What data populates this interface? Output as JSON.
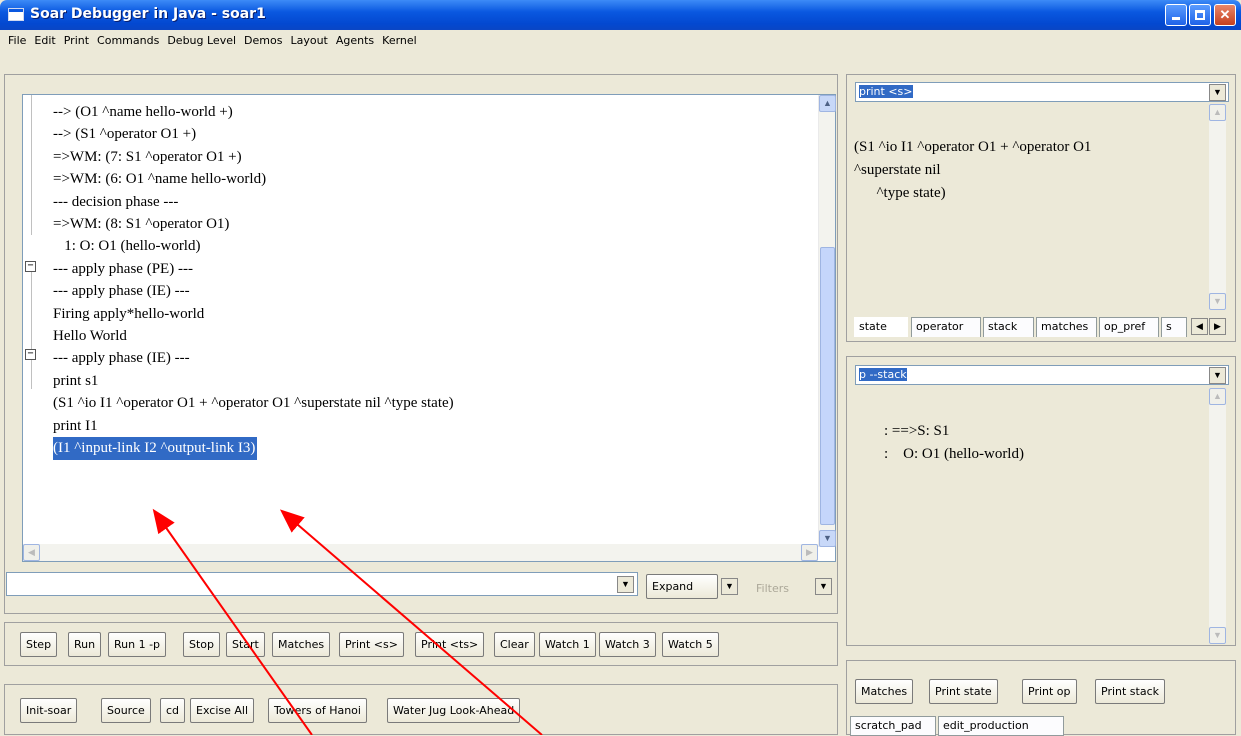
{
  "window": {
    "title": "Soar Debugger in Java - soar1"
  },
  "menu": [
    "File",
    "Edit",
    "Print",
    "Commands",
    "Debug Level",
    "Demos",
    "Layout",
    "Agents",
    "Kernel"
  ],
  "trace": {
    "lines": [
      "--> (O1 ^name hello-world +)",
      "--> (S1 ^operator O1 +)",
      "=>WM: (7: S1 ^operator O1 +)",
      "=>WM: (6: O1 ^name hello-world)",
      "--- decision phase ---",
      "=>WM: (8: S1 ^operator O1)",
      "   1: O: O1 (hello-world)",
      "--- apply phase (PE) ---",
      "--- apply phase (IE) ---",
      "Firing apply*hello-world",
      "Hello World",
      "--- apply phase (IE) ---",
      "print s1",
      "(S1 ^io I1 ^operator O1 + ^operator O1 ^superstate nil ^type state)",
      "print I1",
      "(I1 ^input-link I2 ^output-link I3)"
    ],
    "selected_line": "(I1 ^input-link I2 ^output-link I3)"
  },
  "command": {
    "value": "",
    "expand_label": "Expand",
    "filters_label": "Filters"
  },
  "buttons_row1": [
    "Step",
    "Run",
    "Run 1 -p",
    "Stop",
    "Start",
    "Matches",
    "Print <s>",
    "Print <ts>",
    "Clear",
    "Watch 1",
    "Watch 3",
    "Watch 5"
  ],
  "buttons_row2": [
    "Init-soar",
    "Source",
    "cd",
    "Excise All",
    "Towers of Hanoi",
    "Water Jug Look-Ahead"
  ],
  "state_view": {
    "command": "print <s>",
    "text_lines": [
      "(S1 ^io I1 ^operator O1 + ^operator O1",
      "^superstate nil",
      "      ^type state)"
    ],
    "tabs": [
      "state",
      "operator",
      "stack",
      "matches",
      "op_pref",
      "s"
    ]
  },
  "stack_view": {
    "command": "p --stack",
    "text_lines": [
      ": ==>S: S1",
      ":    O: O1 (hello-world)"
    ]
  },
  "right_buttons": [
    "Matches",
    "Print state",
    "Print op",
    "Print stack"
  ],
  "bottom_tabs": [
    "scratch_pad",
    "edit_production"
  ],
  "colors": {
    "selection": "#316ac5",
    "annotation_arrow": "#ff0000",
    "titlebar": "#0a58e0"
  }
}
